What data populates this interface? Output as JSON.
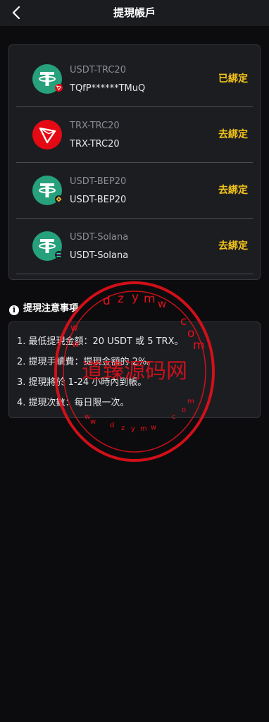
{
  "header": {
    "title": "提現帳戶",
    "back_icon": "chevron-left-icon"
  },
  "accounts": [
    {
      "name": "USDT-TRC20",
      "value": "TQfP******TMuQ",
      "action": "已綁定",
      "icon": "tether-icon",
      "badge": "tron-badge-icon"
    },
    {
      "name": "TRX-TRC20",
      "value": "TRX-TRC20",
      "action": "去綁定",
      "icon": "tron-icon"
    },
    {
      "name": "USDT-BEP20",
      "value": "USDT-BEP20",
      "action": "去綁定",
      "icon": "tether-icon",
      "badge": "bnb-badge-icon"
    },
    {
      "name": "USDT-Solana",
      "value": "USDT-Solana",
      "action": "去綁定",
      "icon": "tether-icon",
      "badge": "solana-badge-icon"
    }
  ],
  "notice": {
    "title": "提現注意事項",
    "icon": "info-icon",
    "items": [
      "1. 最低提現金額：20 USDT 或 5 TRX。",
      "2. 提現手續費：提現金額的 2%。",
      "3. 提現將於 1-24 小時內到帳。",
      "4. 提現次數：每日限一次。"
    ]
  },
  "watermark": {
    "text": "道臻源码网",
    "ring_text": "w w w . d z y m w . c o m"
  },
  "colors": {
    "background": "#0c0c0e",
    "header": "#1b1c1f",
    "card": "#1c1d21",
    "accent": "#f5c518",
    "tether_green": "#26a17b",
    "tron_red": "#e50914",
    "stamp_red": "#e8101a"
  }
}
